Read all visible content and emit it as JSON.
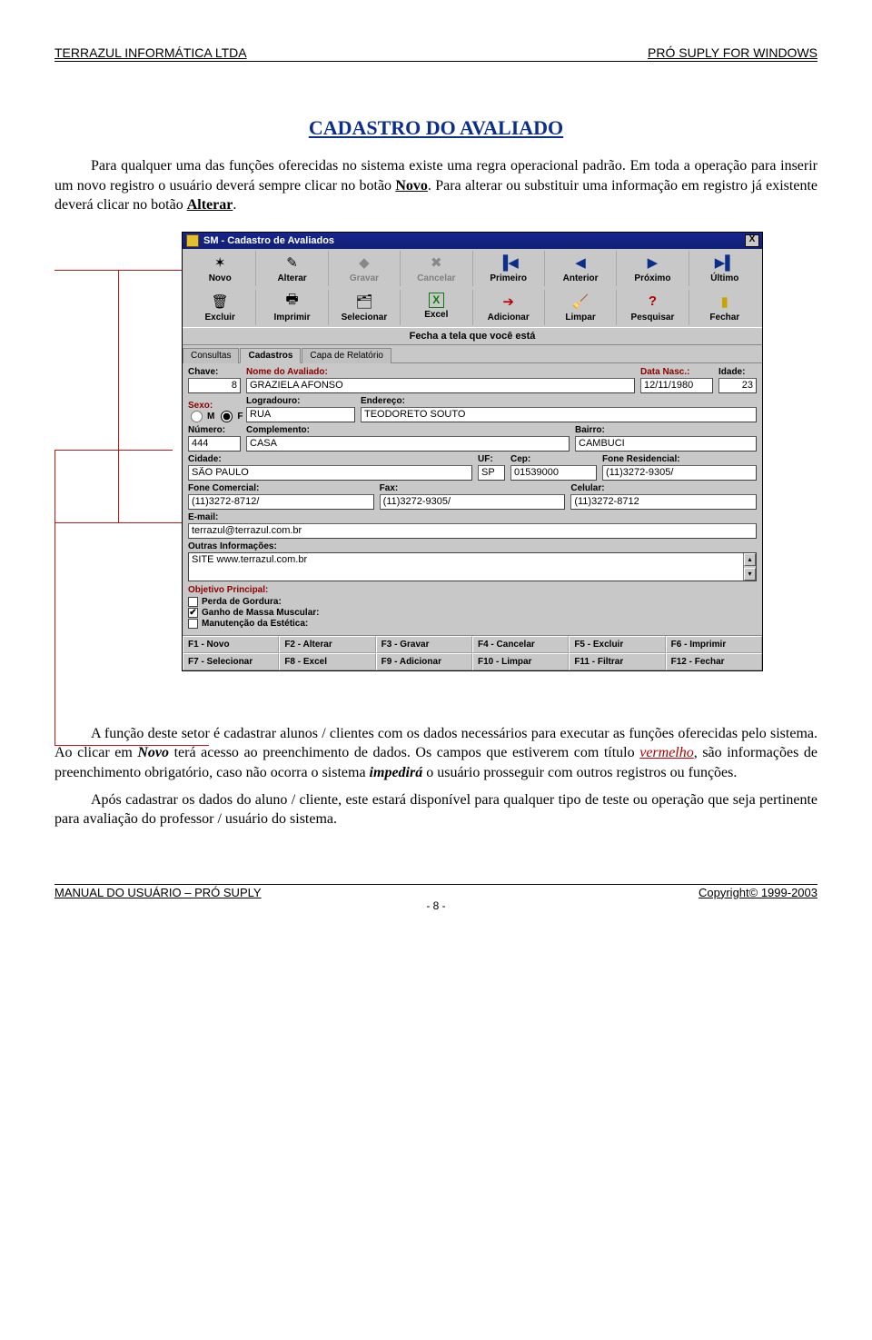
{
  "header": {
    "left": "TERRAZUL INFORMÁTICA LTDA",
    "right": "PRÓ SUPLY FOR WINDOWS"
  },
  "title": "CADASTRO DO AVALIADO",
  "para1_a": "Para qualquer uma das funções oferecidas no sistema existe uma regra operacional padrão. Em toda a operação para inserir um novo registro o usuário deverá sempre clicar no botão ",
  "para1_novo": "Novo",
  "para1_b": ". Para alterar ou substituir uma informação em registro já existente deverá clicar no botão ",
  "para1_alt": "Alterar",
  "para1_c": ".",
  "win": {
    "title": "SM - Cadastro de Avaliados",
    "close": "X",
    "row1": [
      {
        "icon": "✶",
        "label": "Novo"
      },
      {
        "icon": "✎",
        "label": "Alterar"
      },
      {
        "icon": "◆",
        "label": "Gravar",
        "disabled": true
      },
      {
        "icon": "✖",
        "label": "Cancelar",
        "disabled": true
      },
      {
        "icon": "▐◀",
        "label": "Primeiro"
      },
      {
        "icon": "◀",
        "label": "Anterior"
      },
      {
        "icon": "▶",
        "label": "Próximo"
      },
      {
        "icon": "▶▌",
        "label": "Último"
      }
    ],
    "row2": [
      {
        "icon": "🗑",
        "label": "Excluir"
      },
      {
        "icon": "🖶",
        "label": "Imprimir"
      },
      {
        "icon": "🗂",
        "label": "Selecionar"
      },
      {
        "icon": "X",
        "label": "Excel",
        "color": "#0a7a0a"
      },
      {
        "icon": "➔",
        "label": "Adicionar",
        "color": "#c00000"
      },
      {
        "icon": "🧹",
        "label": "Limpar"
      },
      {
        "icon": "?",
        "label": "Pesquisar",
        "color": "#b00000"
      },
      {
        "icon": "▮",
        "label": "Fechar",
        "color": "#c9a400"
      }
    ],
    "hint": "Fecha a tela que você está",
    "tabs": [
      "Consultas",
      "Cadastros",
      "Capa de Relatório"
    ],
    "fields": {
      "chave": {
        "label": "Chave:",
        "value": "8"
      },
      "nome": {
        "label": "Nome do Avaliado:",
        "value": "GRAZIELA AFONSO"
      },
      "dnasc": {
        "label": "Data Nasc.:",
        "value": "12/11/1980"
      },
      "idade": {
        "label": "Idade:",
        "value": "23"
      },
      "sexo": {
        "label": "Sexo:",
        "m": "M",
        "f": "F"
      },
      "logr": {
        "label": "Logradouro:",
        "value": "RUA"
      },
      "end": {
        "label": "Endereço:",
        "value": "TEODORETO SOUTO"
      },
      "num": {
        "label": "Número:",
        "value": "444"
      },
      "comp": {
        "label": "Complemento:",
        "value": "CASA"
      },
      "bairro": {
        "label": "Bairro:",
        "value": "CAMBUCI"
      },
      "cidade": {
        "label": "Cidade:",
        "value": "SÃO PAULO"
      },
      "uf": {
        "label": "UF:",
        "value": "SP"
      },
      "cep": {
        "label": "Cep:",
        "value": "01539000"
      },
      "foneres": {
        "label": "Fone Residencial:",
        "value": "(11)3272-9305/"
      },
      "fonecom": {
        "label": "Fone Comercial:",
        "value": "(11)3272-8712/"
      },
      "fax": {
        "label": "Fax:",
        "value": "(11)3272-9305/"
      },
      "cel": {
        "label": "Celular:",
        "value": "(11)3272-8712"
      },
      "email": {
        "label": "E-mail:",
        "value": "terrazul@terrazul.com.br"
      },
      "outras": {
        "label": "Outras Informações:",
        "value": "SITE www.terrazul.com.br"
      },
      "obj_title": "Objetivo Principal:",
      "obj1": "Perda de Gordura:",
      "obj2": "Ganho de Massa Muscular:",
      "obj3": "Manutenção da Estética:"
    },
    "fkeys": [
      "F1 - Novo",
      "F2 - Alterar",
      "F3 - Gravar",
      "F4 - Cancelar",
      "F5 - Excluir",
      "F6 - Imprimir",
      "F7 - Selecionar",
      "F8 - Excel",
      "F9 - Adicionar",
      "F10 - Limpar",
      "F11 - Filtrar",
      "F12 - Fechar"
    ]
  },
  "para2_a": "A função deste setor é cadastrar alunos / clientes com os dados necessários para executar as funções oferecidas pelo sistema. Ao clicar em ",
  "para2_novo": "Novo",
  "para2_b": " terá acesso ao preenchimento de dados. Os campos que estiverem com título ",
  "para2_verm": "vermelho",
  "para2_c": ", são informações de preenchimento obrigatório, caso não ocorra o sistema ",
  "para2_imp": "impedirá",
  "para2_d": " o usuário prosseguir com outros registros ou funções.",
  "para3": "Após cadastrar os dados do aluno / cliente, este estará disponível para qualquer tipo de teste ou operação que seja pertinente para avaliação do professor / usuário do sistema.",
  "footer": {
    "left": "MANUAL DO USUÁRIO – PRÓ SUPLY",
    "right": "Copyright© 1999-2003",
    "page": "- 8 -"
  }
}
